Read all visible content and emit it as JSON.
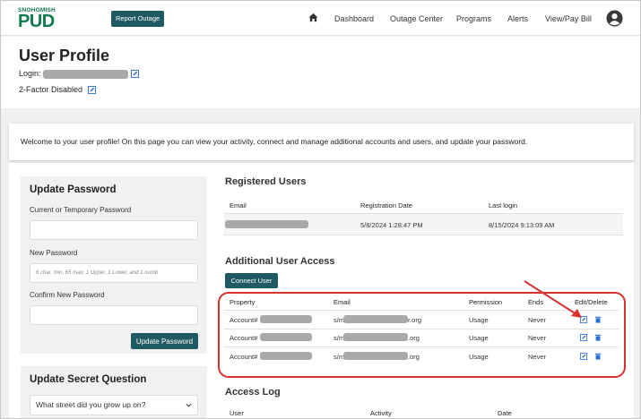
{
  "header": {
    "logo_small": "SNOHOMISH",
    "logo_main": "PUD",
    "report_outage": "Report Outage",
    "nav": [
      "Dashboard",
      "Outage Center",
      "Programs",
      "Alerts",
      "View/Pay Bill"
    ],
    "colors": {
      "brand_green": "#0f7a4a",
      "button_teal": "#1f5a63",
      "highlight_red": "#d93030"
    }
  },
  "profile": {
    "title": "User Profile",
    "login_label": "Login:",
    "twofa": "2-Factor Disabled"
  },
  "welcome": "Welcome to your user profile! On this page you can view your activity, connect and manage additional accounts and users, and update your password.",
  "password": {
    "title": "Update Password",
    "current_label": "Current or Temporary Password",
    "new_label": "New Password",
    "new_placeholder": "6 char. min, 65 max; 1 Upper, 1 Lower, and 1 numb",
    "confirm_label": "Confirm New Password",
    "button": "Update Password"
  },
  "secret": {
    "title": "Update Secret Question",
    "selected": "What street did you grow up on?"
  },
  "registered": {
    "title": "Registered Users",
    "headers": [
      "Email",
      "Registration Date",
      "Last login"
    ],
    "row": {
      "registration": "5/8/2024 1:28:47 PM",
      "last_login": "8/15/2024 9:13:09 AM"
    }
  },
  "access": {
    "title": "Additional User Access",
    "connect": "Connect User",
    "headers": [
      "Property",
      "Email",
      "Permission",
      "Ends",
      "Edit/Delete"
    ],
    "rows": [
      {
        "property": "Account#",
        "email_prefix": "s/m",
        "email_suffix": "r.org",
        "permission": "Usage",
        "ends": "Never"
      },
      {
        "property": "Account#",
        "email_prefix": "s/m",
        "email_suffix": ".org",
        "permission": "Usage",
        "ends": "Never"
      },
      {
        "property": "Account#",
        "email_prefix": "s/m",
        "email_suffix": ".org",
        "permission": "Usage",
        "ends": "Never"
      }
    ]
  },
  "log": {
    "title": "Access Log",
    "headers": [
      "User",
      "Activity",
      "Date"
    ]
  }
}
